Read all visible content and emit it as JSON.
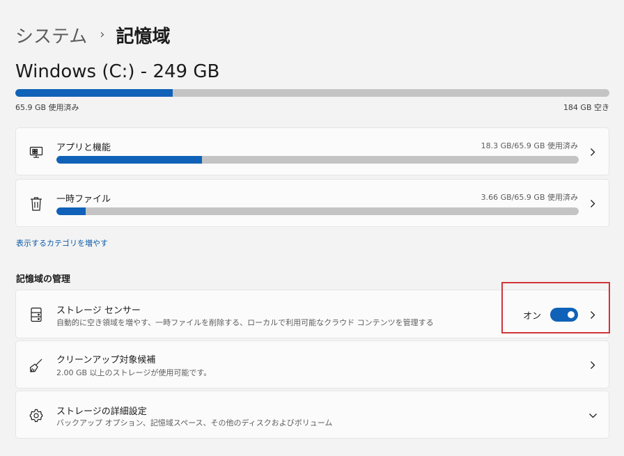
{
  "breadcrumb": {
    "parent": "システム",
    "separator": "›",
    "current": "記憶域"
  },
  "drive": {
    "title": "Windows (C:) - 249 GB",
    "used_label": "65.9 GB 使用済み",
    "free_label": "184 GB 空き",
    "used_fraction": 0.265
  },
  "categories": [
    {
      "label": "アプリと機能",
      "size": "18.3 GB/65.9 GB 使用済み",
      "fraction": 0.278,
      "icon": "apps-icon"
    },
    {
      "label": "一時ファイル",
      "size": "3.66 GB/65.9 GB 使用済み",
      "fraction": 0.056,
      "icon": "trash-icon"
    }
  ],
  "show_more_link": "表示するカテゴリを増やす",
  "management": {
    "section_title": "記憶域の管理",
    "storage_sense": {
      "title": "ストレージ センサー",
      "description": "自動的に空き領域を増やす、一時ファイルを削除する、ローカルで利用可能なクラウド コンテンツを管理する",
      "toggle_label": "オン",
      "toggle_on": true
    },
    "cleanup": {
      "title": "クリーンアップ対象候補",
      "description": "2.00 GB 以上のストレージが使用可能です。"
    },
    "advanced": {
      "title": "ストレージの詳細設定",
      "description": "バックアップ オプション、記憶域スペース、その他のディスクおよびボリューム"
    }
  },
  "colors": {
    "accent": "#0f62b8",
    "bar_track": "#c4c4c4",
    "highlight": "#d13438",
    "link": "#0a5aa8"
  }
}
